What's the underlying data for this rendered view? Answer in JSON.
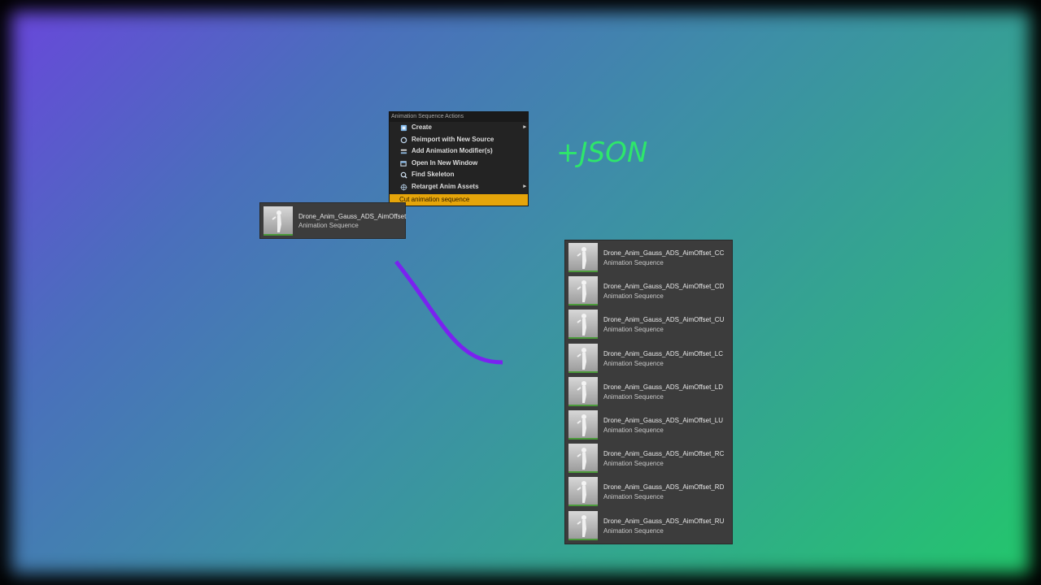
{
  "colors": {
    "gradient_start": "#6a45dc",
    "gradient_end": "#22c86a",
    "menu_highlight": "#e5a50a",
    "connector": "#7a22f0",
    "label_green": "#2ee66b"
  },
  "context_menu": {
    "header": "Animation Sequence Actions",
    "items": [
      {
        "label": "Create",
        "icon": "create-icon",
        "submenu": true
      },
      {
        "label": "Reimport with New Source",
        "icon": "reimport-icon",
        "submenu": false
      },
      {
        "label": "Add Animation Modifier(s)",
        "icon": "modifier-icon",
        "submenu": false
      },
      {
        "label": "Open In New Window",
        "icon": "open-window-icon",
        "submenu": false
      },
      {
        "label": "Find Skeleton",
        "icon": "find-icon",
        "submenu": false
      },
      {
        "label": "Retarget Anim Assets",
        "icon": "retarget-icon",
        "submenu": true
      }
    ],
    "highlighted_item": "Cut animation sequence",
    "submenu_arrow": "▸"
  },
  "source_asset": {
    "name": "Drone_Anim_Gauss_ADS_AimOffset",
    "type": "Animation Sequence"
  },
  "annotation": "+JSON",
  "result_assets": [
    {
      "name": "Drone_Anim_Gauss_ADS_AimOffset_CC",
      "type": "Animation Sequence"
    },
    {
      "name": "Drone_Anim_Gauss_ADS_AimOffset_CD",
      "type": "Animation Sequence"
    },
    {
      "name": "Drone_Anim_Gauss_ADS_AimOffset_CU",
      "type": "Animation Sequence"
    },
    {
      "name": "Drone_Anim_Gauss_ADS_AimOffset_LC",
      "type": "Animation Sequence"
    },
    {
      "name": "Drone_Anim_Gauss_ADS_AimOffset_LD",
      "type": "Animation Sequence"
    },
    {
      "name": "Drone_Anim_Gauss_ADS_AimOffset_LU",
      "type": "Animation Sequence"
    },
    {
      "name": "Drone_Anim_Gauss_ADS_AimOffset_RC",
      "type": "Animation Sequence"
    },
    {
      "name": "Drone_Anim_Gauss_ADS_AimOffset_RD",
      "type": "Animation Sequence"
    },
    {
      "name": "Drone_Anim_Gauss_ADS_AimOffset_RU",
      "type": "Animation Sequence"
    }
  ]
}
